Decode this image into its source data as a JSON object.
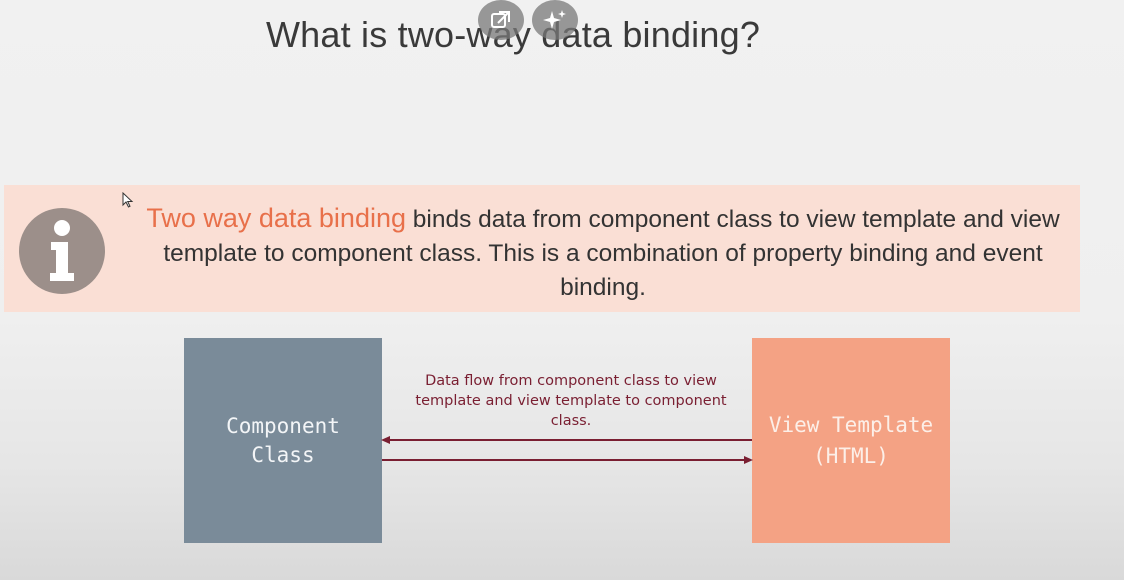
{
  "slide": {
    "title": "What is two-way data binding?"
  },
  "overlay": {
    "popout_icon": "popout-icon",
    "sparkle_icon": "sparkle-icon"
  },
  "info": {
    "icon": "info-icon",
    "highlight": "Two way data binding",
    "text": " binds data from component class to view template and view template to component class. This is a combination of property binding and event binding."
  },
  "diagram": {
    "component_box": {
      "line1": "Component",
      "line2": "Class"
    },
    "view_box": {
      "line1": "View Template",
      "line2": "(HTML)"
    },
    "flow_label": "Data flow from component class to view template and view template to component class."
  },
  "colors": {
    "title_text": "#3a3a3a",
    "info_bg": "#fadfd5",
    "info_highlight": "#e8704a",
    "info_icon": "#9c8f8a",
    "component_box": "#7a8b99",
    "view_box": "#f4a284",
    "arrow": "#7a1f32"
  }
}
